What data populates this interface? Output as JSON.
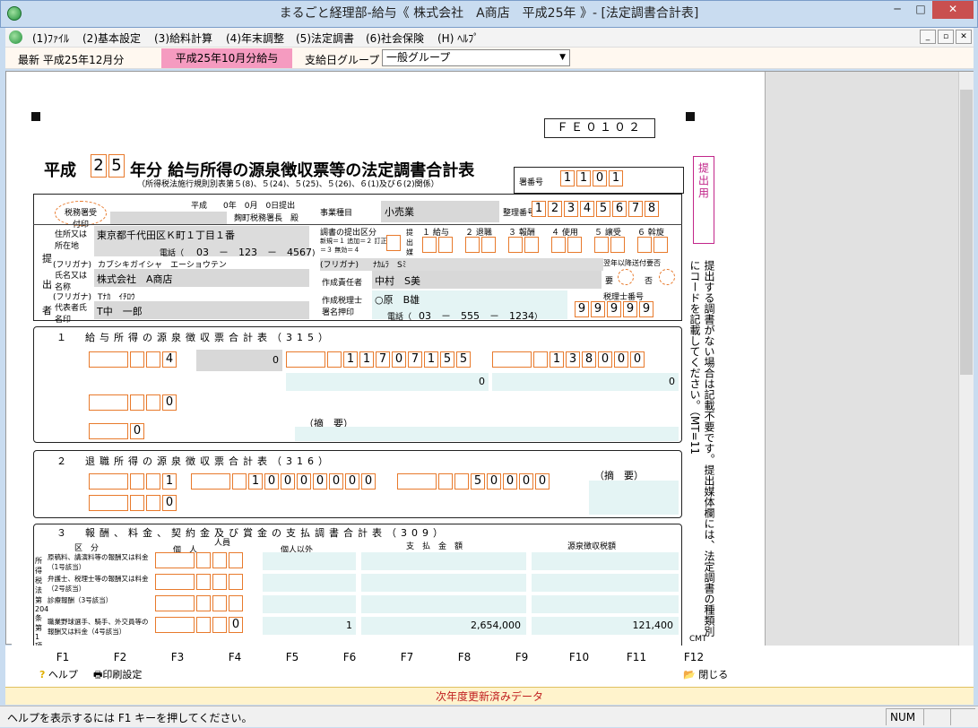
{
  "window": {
    "title": "まるごと経理部-給与《 株式会社　A商店　平成25年 》- [法定調書合計表]",
    "minimize": "─",
    "maximize": "□",
    "close": "✕"
  },
  "menu": {
    "items": [
      "(1)ﾌｧｲﾙ",
      "(2)基本設定",
      "(3)給料計算",
      "(4)年末調整",
      "(5)法定調書",
      "(6)社会保険",
      "(H) ﾍﾙﾌﾟ"
    ]
  },
  "toolbar": {
    "latest_label": "最新 平成25年12月分",
    "pink_label": "平成25年10月分給与",
    "group_label": "支給日グループ",
    "group_value": "一般グループ"
  },
  "form": {
    "code": "ＦＥ０１０２",
    "title_prefix": "平成",
    "year_digits": [
      "2",
      "5"
    ],
    "title_main": "年分 給与所得の源泉徴収票等の法定調書合計表",
    "subtitle": "（所得税法施行規則別表第５(8)、５(24)、５(25)、５(26)、６(1)及び６(2)関係）",
    "side_vertical": "提出用",
    "tax_office_stamp": "税務署受付印",
    "office_no_label": "署番号",
    "office_no": [
      "1",
      "1",
      "0",
      "1"
    ],
    "reg_no_label": "整理番号",
    "reg_no": [
      "1",
      "2",
      "3",
      "4",
      "5",
      "6",
      "7",
      "8"
    ],
    "date_row": "平成　　0年　0月　0日提出",
    "tax_office_chief": "麹町税務署長　殿",
    "business_label": "事業種目",
    "business_value": "小売業",
    "addr_label": "住所又は所在地",
    "addr_value": "東京都千代田区Ｋ町１丁目１番",
    "tel_label": "電話（",
    "tel_value": "03　－　123　－　4567",
    "furigana_label": "(フリガナ)",
    "furigana_name": "カブシキガイシャ　エーショウテン",
    "name_label": "氏名又は名称",
    "name_value": "株式会社　A商店",
    "rep_furigana": "Tﾅｶ　ｲﾁﾛｳ",
    "rep_label": "代表者氏名印",
    "rep_name": "T中　一郎",
    "submit_class_label": "調書の提出区分",
    "submit_class_note": "新規＝１ 追加＝２ 訂正＝３ 無効＝４",
    "media_label": "提出媒体",
    "media_cols": [
      "１ 給与",
      "２ 退職",
      "３ 報酬",
      "４ 使用",
      "５ 譲受",
      "６ 斡旋"
    ],
    "person_furigana": "ﾅｶﾑﾗ　Sﾐ",
    "person_label": "作成責任者",
    "person_name": "中村　S美",
    "next_year_label": "翌年以降送付要否",
    "yes": "要",
    "no": "否",
    "accountant_label": "作成税理士署名押印",
    "accountant_name": "○原　B雄",
    "acc_tel": "03　－　555　－　1234",
    "accountant_no_label": "税理士番号",
    "accountant_no": [
      "9",
      "9",
      "9",
      "9",
      "9"
    ],
    "side_note": "提出する調書がない場合は記載不要です。提出媒体欄には、法定調書の種類別にコードを記載してください。（MT=11",
    "cmt": "CMT",
    "sec1_title": "１　給与所得の源泉徴収票合計表（315）",
    "sec1_row1": {
      "count": "4",
      "zero": "0",
      "pay": [
        "1",
        "1",
        "7",
        "0",
        "7",
        "1",
        "5",
        "5"
      ],
      "tax": [
        "1",
        "3",
        "8",
        "0",
        "0",
        "0"
      ]
    },
    "sec1_row2": {
      "pay": "0",
      "tax": "0"
    },
    "sec1_row3": {
      "count": "0"
    },
    "sec1_row4": {
      "count": "0",
      "summary": "（摘　要）"
    },
    "sec2_title": "２　退職所得の源泉徴収票合計表（316）",
    "sec2_summary": "（摘　要）",
    "sec2_row1": {
      "count": "1",
      "pay": [
        "1",
        "0",
        "0",
        "0",
        "0",
        "0",
        "0",
        "0"
      ],
      "tax": [
        "5",
        "0",
        "0",
        "0",
        "0"
      ]
    },
    "sec2_row2": {
      "count": "0"
    },
    "sec3_title": "３　報酬、料金、契約金及び賞金の支払調書合計表（309）",
    "sec3_headers": [
      "区　分",
      "人員",
      "個　人",
      "個人以外",
      "支　払　金　額",
      "源泉徴収税額"
    ],
    "sec3_unit_person": "人",
    "sec3_unit_yen": "円",
    "sec3_side": "所得税法第204条第1項に規定",
    "sec3_rows": [
      {
        "label": "原稿料、講演料等の報酬又は料金（1号該当）",
        "count": "",
        "other": "",
        "pay": "",
        "tax": ""
      },
      {
        "label": "弁護士、税理士等の報酬又は料金（2号該当）",
        "count": "",
        "other": "",
        "pay": "",
        "tax": ""
      },
      {
        "label": "診療報酬（3号該当）",
        "count": "",
        "other": "",
        "pay": "",
        "tax": ""
      },
      {
        "label": "職業野球選手、騎手、外交員等の報酬又は料金（4号該当）",
        "count": "0",
        "other": "1",
        "pay": "2,654,000",
        "tax": "121,400"
      }
    ]
  },
  "fkeys": {
    "keys": [
      "F1",
      "F2",
      "F3",
      "F4",
      "F5",
      "F6",
      "F7",
      "F8",
      "F9",
      "F10",
      "F11",
      "F12"
    ],
    "help": "ヘルプ",
    "print": "印刷設定",
    "close": "閉じる"
  },
  "status": {
    "notice": "次年度更新済みデータ",
    "help_text": "ヘルプを表示するには F1 キーを押してください。",
    "num": "NUM"
  }
}
